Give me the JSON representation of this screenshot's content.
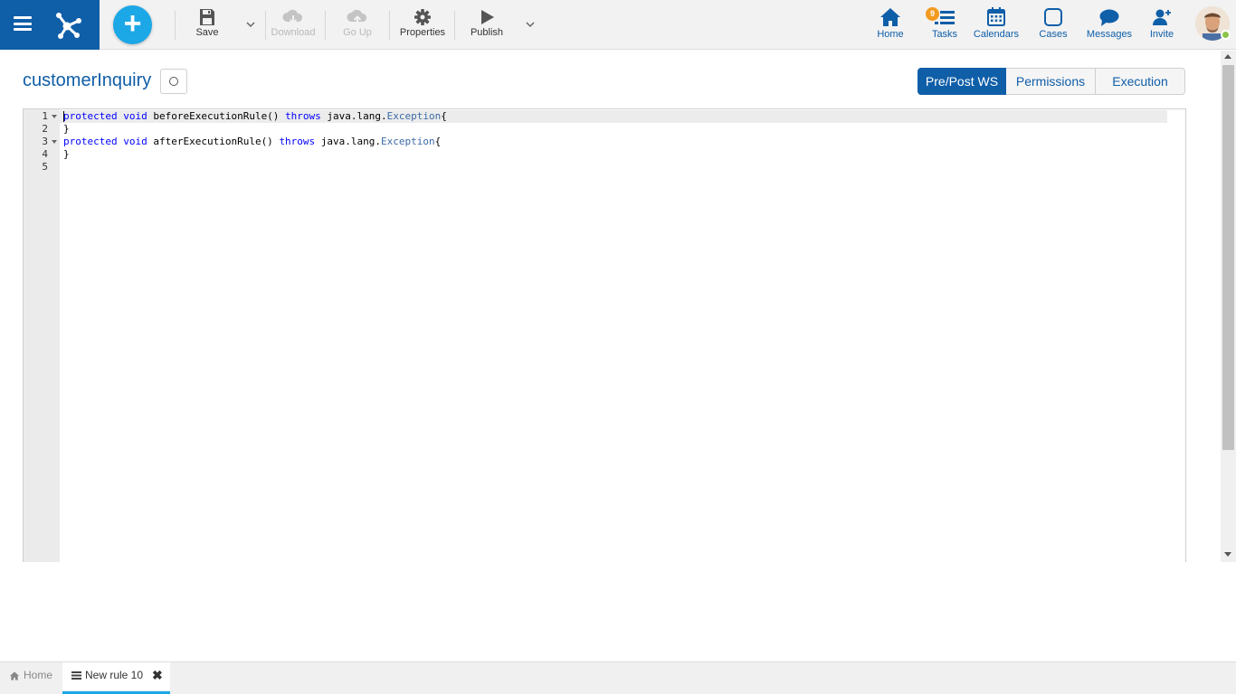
{
  "toolbar": {
    "save": "Save",
    "download": "Download",
    "go_up": "Go Up",
    "properties": "Properties",
    "publish": "Publish"
  },
  "nav": {
    "home": "Home",
    "tasks": "Tasks",
    "tasks_badge": "9",
    "calendars": "Calendars",
    "cases": "Cases",
    "messages": "Messages",
    "invite": "Invite"
  },
  "page": {
    "title": "customerInquiry"
  },
  "tabs": [
    {
      "label": "Pre/Post WS",
      "active": true
    },
    {
      "label": "Permissions",
      "active": false
    },
    {
      "label": "Execution",
      "active": false
    }
  ],
  "editor": {
    "lines": [
      {
        "num": "1",
        "tokens": [
          {
            "t": "protected",
            "c": "kw"
          },
          {
            "t": " "
          },
          {
            "t": "void",
            "c": "kw"
          },
          {
            "t": " beforeExecutionRule() "
          },
          {
            "t": "throws",
            "c": "kw"
          },
          {
            "t": " java.lang."
          },
          {
            "t": "Exception",
            "c": "ty"
          },
          {
            "t": "{"
          }
        ]
      },
      {
        "num": "2",
        "tokens": [
          {
            "t": "}"
          }
        ]
      },
      {
        "num": "3",
        "tokens": [
          {
            "t": "protected",
            "c": "kw"
          },
          {
            "t": " "
          },
          {
            "t": "void",
            "c": "kw"
          },
          {
            "t": " afterExecutionRule() "
          },
          {
            "t": "throws",
            "c": "kw"
          },
          {
            "t": " java.lang."
          },
          {
            "t": "Exception",
            "c": "ty"
          },
          {
            "t": "{"
          }
        ]
      },
      {
        "num": "4",
        "tokens": [
          {
            "t": "}"
          }
        ]
      },
      {
        "num": "5",
        "tokens": []
      }
    ]
  },
  "bottom_tabs": {
    "home": "Home",
    "current": "New rule 10"
  },
  "colors": {
    "brand": "#0f5ea8",
    "accent": "#1ca7e6",
    "badge": "#f29a1f",
    "keyword": "#0000ff"
  }
}
